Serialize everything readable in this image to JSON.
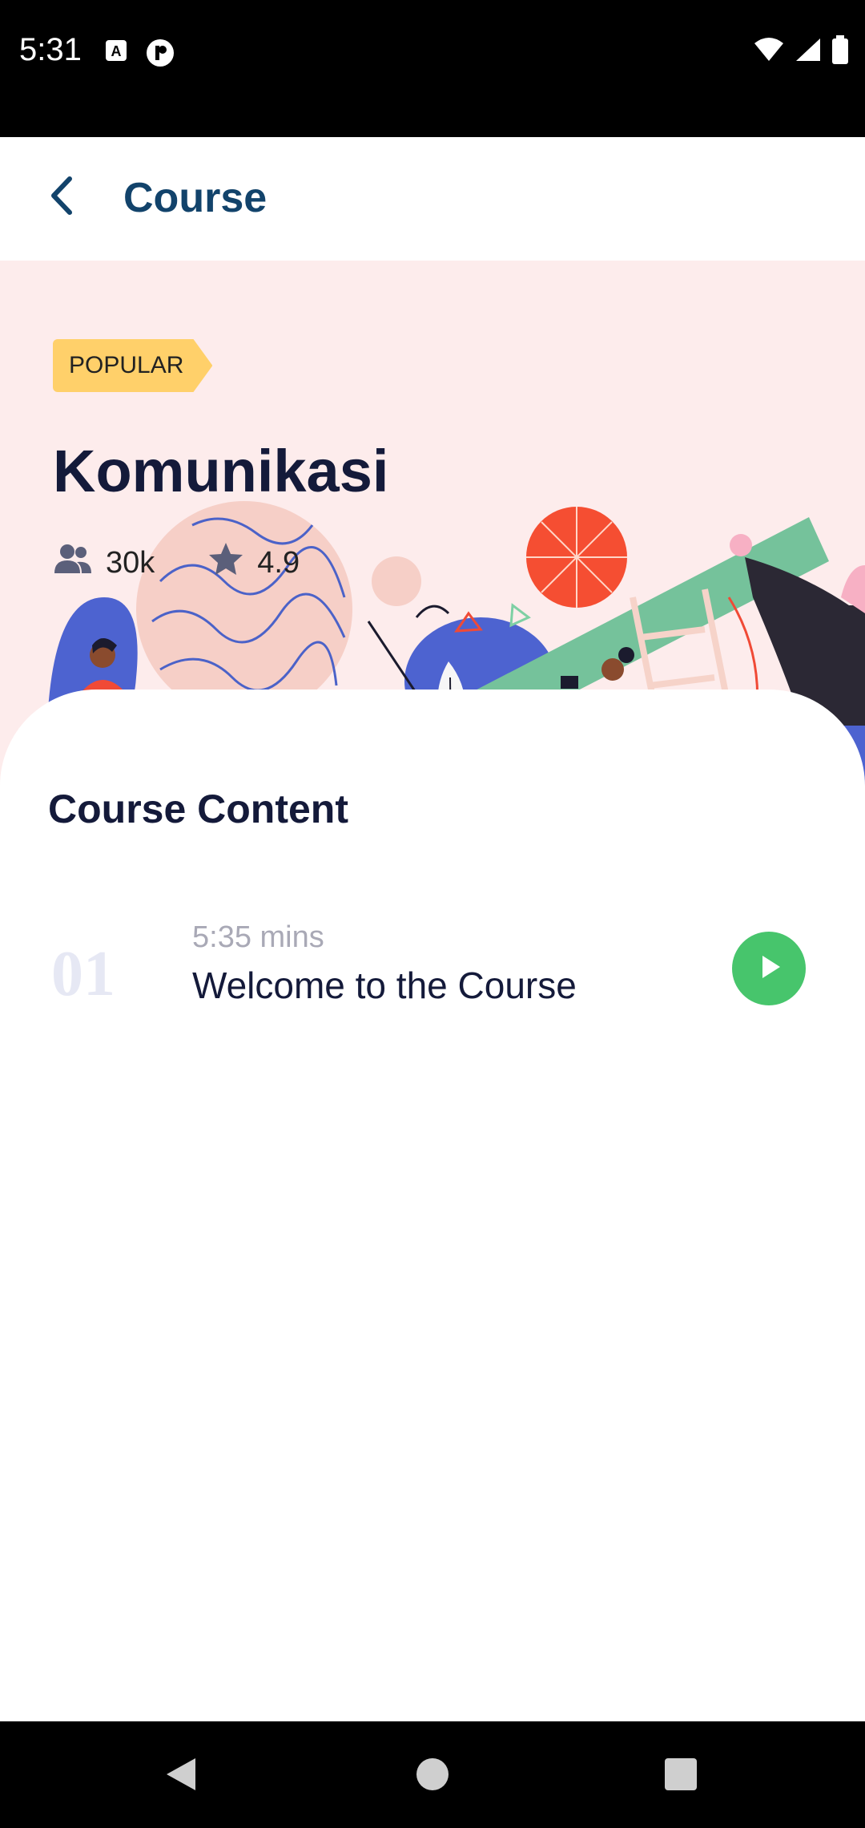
{
  "status_bar": {
    "time": "5:31",
    "left_icons": [
      "a-notification-icon",
      "p-notification-icon"
    ],
    "right_icons": [
      "wifi-icon",
      "signal-icon",
      "battery-icon"
    ]
  },
  "app_bar": {
    "back_icon": "chevron-left-icon",
    "title": "Course"
  },
  "hero": {
    "badge": "POPULAR",
    "title": "Komunikasi",
    "students": "30k",
    "rating": "4.9",
    "colors": {
      "background": "#fdecec",
      "badge": "#ffd06a"
    }
  },
  "content": {
    "section_title": "Course Content",
    "lessons": [
      {
        "number": "01",
        "duration": "5:35 mins",
        "title": "Welcome to the Course",
        "action_icon": "play-icon"
      }
    ]
  },
  "nav_bar": {
    "icons": [
      "back-triangle-icon",
      "home-circle-icon",
      "recents-square-icon"
    ]
  },
  "colors": {
    "accent": "#12436b",
    "play": "#47c56c",
    "text_dark": "#141a3a"
  }
}
